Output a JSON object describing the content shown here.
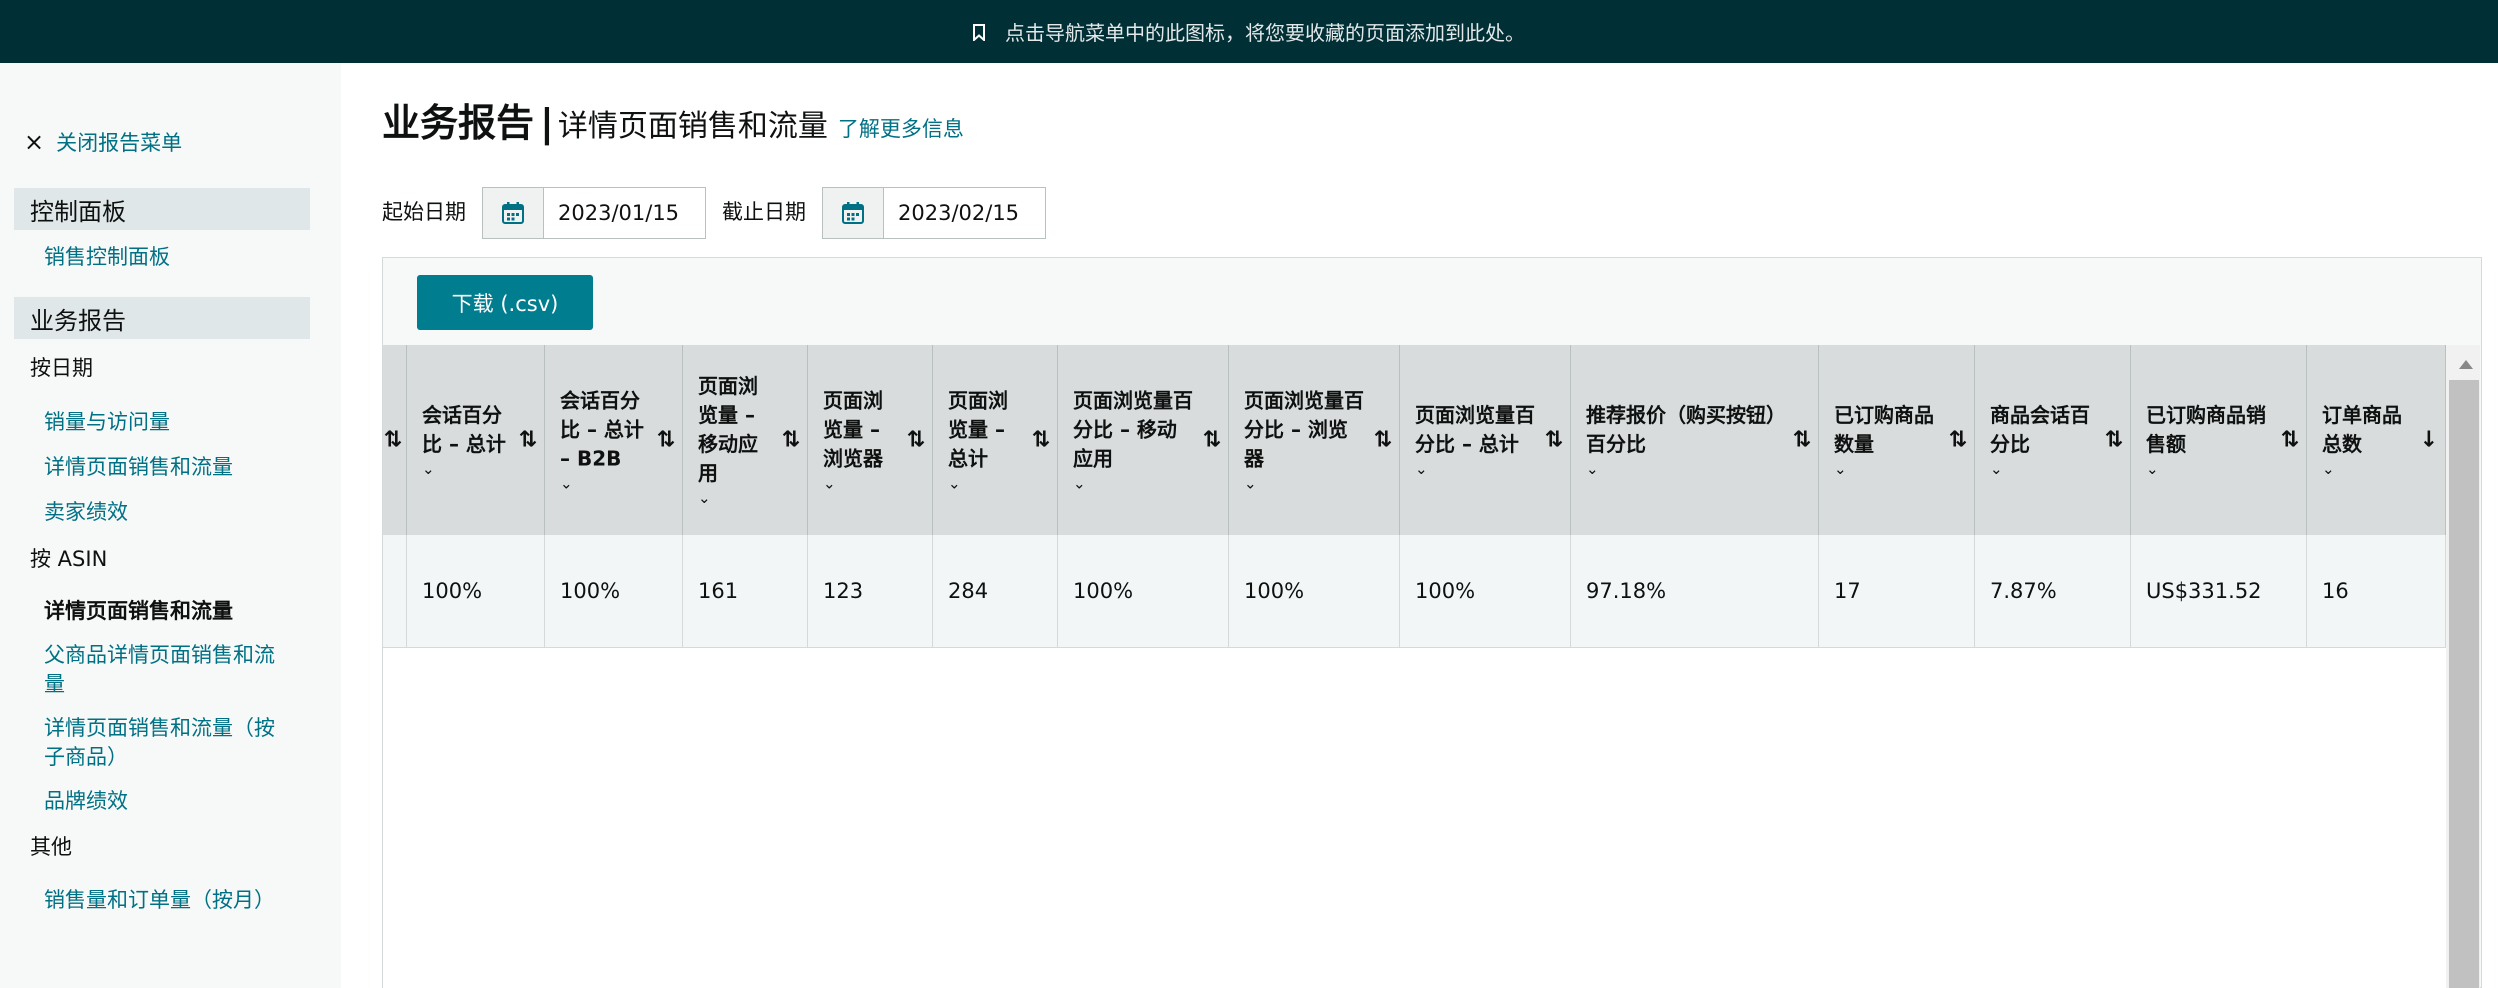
{
  "banner": {
    "icon": "bookmark-icon",
    "text": "点击导航菜单中的此图标，将您要收藏的页面添加到此处。"
  },
  "sidebar": {
    "close_label": "关闭报告菜单",
    "sections": [
      {
        "title": "控制面板",
        "links": [
          "销售控制面板"
        ]
      },
      {
        "title": "业务报告"
      }
    ],
    "groups": {
      "by_date": {
        "label": "按日期",
        "links": [
          "销量与访问量",
          "详情页面销售和流量",
          "卖家绩效"
        ]
      },
      "by_asin": {
        "label": "按 ASIN",
        "links": [
          "详情页面销售和流量",
          "父商品详情页面销售和流量",
          "详情页面销售和流量（按子商品）",
          "品牌绩效"
        ]
      },
      "other": {
        "label": "其他",
        "links": [
          "销售量和订单量（按月）"
        ]
      }
    }
  },
  "page": {
    "title_main": "业务报告",
    "separator": "|",
    "title_sub": "详情页面销售和流量",
    "learn_more": "了解更多信息"
  },
  "dates": {
    "start_label": "起始日期",
    "start_value": "2023/01/15",
    "end_label": "截止日期",
    "end_value": "2023/02/15"
  },
  "download_label": "下载 (.csv)",
  "table": {
    "headers": [
      {
        "label": "会话百分比 – 总计",
        "sort": "⇅"
      },
      {
        "label": "会话百分比 – 总计 – B2B",
        "sort": "⇅"
      },
      {
        "label": "页面浏览量 – 移动应用",
        "sort": "⇅"
      },
      {
        "label": "页面浏览量 – 浏览器",
        "sort": "⇅"
      },
      {
        "label": "页面浏览量 – 总计",
        "sort": "⇅"
      },
      {
        "label": "页面浏览量百分比 – 移动应用",
        "sort": "⇅"
      },
      {
        "label": "页面浏览量百分比 – 浏览器",
        "sort": "⇅"
      },
      {
        "label": "页面浏览量百分比 – 总计",
        "sort": "⇅"
      },
      {
        "label": "推荐报价（购买按钮）百分比",
        "sort": "⇅"
      },
      {
        "label": "已订购商品数量",
        "sort": "⇅"
      },
      {
        "label": "商品会话百分比",
        "sort": "⇅"
      },
      {
        "label": "已订购商品销售额",
        "sort": "⇅"
      },
      {
        "label": "订单商品总数",
        "sort": "↓"
      }
    ],
    "row": [
      "100%",
      "100%",
      "161",
      "123",
      "284",
      "100%",
      "100%",
      "100%",
      "97.18%",
      "17",
      "7.87%",
      "US$331.52",
      "16"
    ]
  },
  "colors": {
    "banner": "#002f36",
    "link": "#007185",
    "button": "#007d8f",
    "header_bg": "#d8dcdc"
  }
}
